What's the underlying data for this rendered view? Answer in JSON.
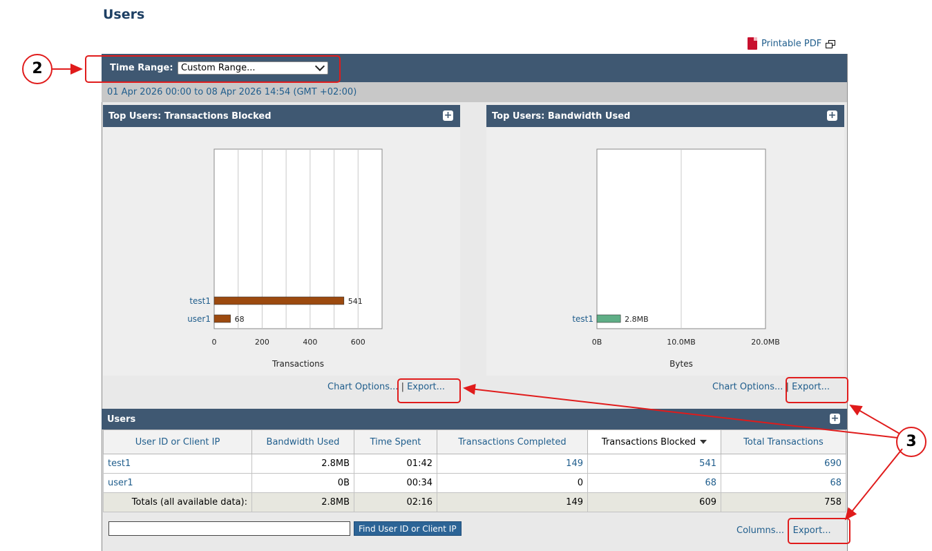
{
  "page": {
    "title": "Users",
    "printable_pdf": "Printable PDF"
  },
  "time_range": {
    "label": "Time Range:",
    "selected": "Custom Range...",
    "date_text": "01 Apr 2026 00:00 to 08 Apr 2026 14:54 (GMT +02:00)"
  },
  "panels": {
    "blocked": {
      "title": "Top Users: Transactions Blocked",
      "chart_options": "Chart Options...",
      "sep": "|",
      "export": "Export..."
    },
    "bandwidth": {
      "title": "Top Users: Bandwidth Used",
      "chart_options": "Chart Options...",
      "sep": "|",
      "export": "Export..."
    }
  },
  "chart_data": [
    {
      "type": "bar",
      "orientation": "horizontal",
      "categories": [
        "test1",
        "user1"
      ],
      "values": [
        541,
        68
      ],
      "value_labels": [
        "541",
        "68"
      ],
      "xlabel": "Transactions",
      "ylabel": "",
      "xlim": [
        0,
        700
      ],
      "xticks": [
        "0",
        "200",
        "400",
        "600"
      ],
      "color": "#9c4a0f",
      "grid": true
    },
    {
      "type": "bar",
      "orientation": "horizontal",
      "categories": [
        "test1"
      ],
      "values": [
        2.8
      ],
      "unit": "MB",
      "value_labels": [
        "2.8MB"
      ],
      "xlabel": "Bytes",
      "ylabel": "",
      "xlim": [
        0,
        20
      ],
      "xticks": [
        "0B",
        "10.0MB",
        "20.0MB"
      ],
      "color": "#5fae86",
      "grid": true
    }
  ],
  "users_table": {
    "title": "Users",
    "columns": [
      "User ID or Client IP",
      "Bandwidth Used",
      "Time Spent",
      "Transactions Completed",
      "Transactions Blocked",
      "Total Transactions"
    ],
    "rows": [
      [
        "test1",
        "2.8MB",
        "01:42",
        "149",
        "541",
        "690"
      ],
      [
        "user1",
        "0B",
        "00:34",
        "0",
        "68",
        "68"
      ]
    ],
    "totals": [
      "Totals (all available data):",
      "2.8MB",
      "02:16",
      "149",
      "609",
      "758"
    ],
    "find_button": "Find User ID or Client IP",
    "find_value": "",
    "columns_link": "Columns...",
    "sep": "|",
    "export": "Export..."
  },
  "annotations": {
    "callout_2": "2",
    "callout_3": "3",
    "accent_color": "#e01b1b"
  }
}
